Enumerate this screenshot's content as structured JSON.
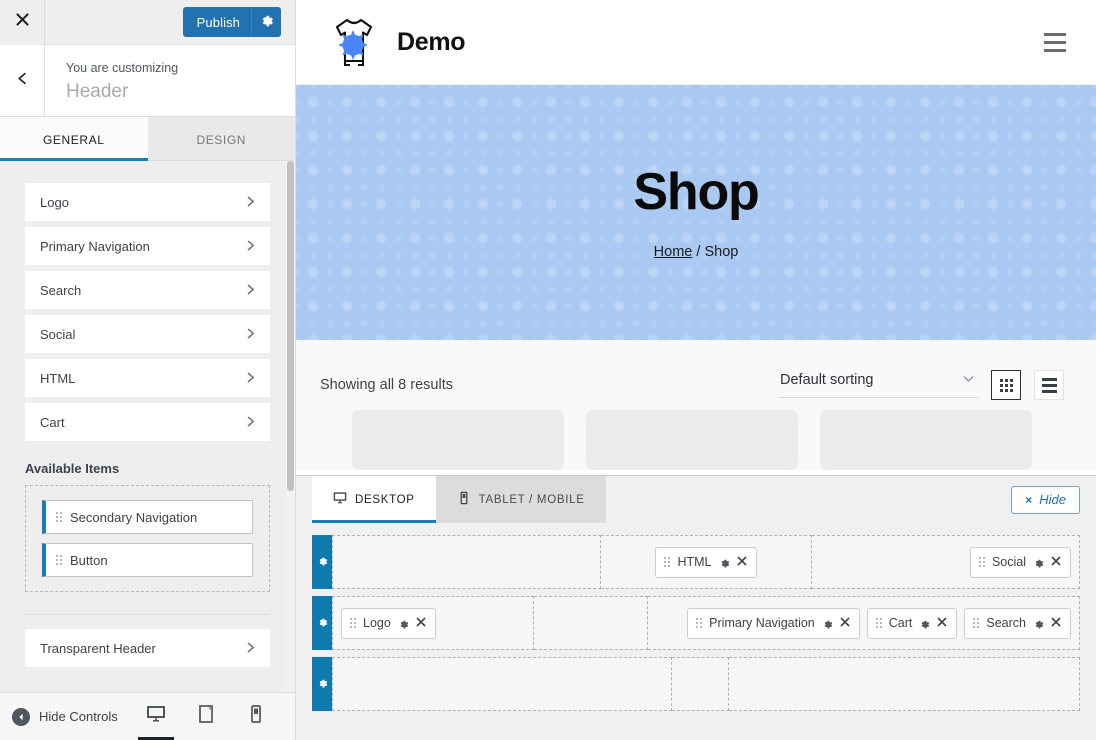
{
  "customizer": {
    "close_icon": "close-icon",
    "publish_label": "Publish",
    "publish_gear_icon": "gear-icon",
    "back_icon": "chevron-left-icon",
    "kicker": "You are customizing",
    "panel_title": "Header",
    "tabs": [
      {
        "label": "GENERAL",
        "active": true
      },
      {
        "label": "DESIGN",
        "active": false
      }
    ],
    "panel_rows": [
      {
        "label": "Logo"
      },
      {
        "label": "Primary Navigation"
      },
      {
        "label": "Search"
      },
      {
        "label": "Social"
      },
      {
        "label": "HTML"
      },
      {
        "label": "Cart"
      }
    ],
    "available_items_title": "Available Items",
    "available_items": [
      {
        "label": "Secondary Navigation"
      },
      {
        "label": "Button"
      }
    ],
    "transparent_header": {
      "label": "Transparent Header"
    },
    "footer": {
      "hide_controls_label": "Hide Controls",
      "devices": [
        {
          "name": "desktop",
          "active": true
        },
        {
          "name": "tablet",
          "active": false
        },
        {
          "name": "mobile",
          "active": false
        }
      ]
    },
    "accent_color": "#2271b1",
    "tab_underline_color": "#1a7fb3"
  },
  "preview": {
    "site_header": {
      "logo_icon": "tshirt-logo-icon",
      "brand": "Demo",
      "menu_icon": "hamburger-menu-icon"
    },
    "hero": {
      "title": "Shop",
      "breadcrumb_home": "Home",
      "breadcrumb_sep": "/",
      "breadcrumb_current": "Shop",
      "background_color": "#a9c9f2"
    },
    "shop": {
      "results_text": "Showing all 8 results",
      "sorting_value": "Default sorting",
      "sorting_caret_icon": "chevron-down-icon",
      "grid_view_icon": "grid-view-icon",
      "list_view_icon": "list-view-icon",
      "grid_active": true
    }
  },
  "builder": {
    "tabs": [
      {
        "label": "DESKTOP",
        "icon": "desktop-icon",
        "active": true
      },
      {
        "label": "TABLET / MOBILE",
        "icon": "mobile-icon",
        "active": false
      }
    ],
    "hide_label": "Hide",
    "hide_x": "×",
    "rows": [
      {
        "name": "top-row",
        "gear_icon": "gear-icon",
        "zones": [
          {
            "align": "left",
            "flex": 1.3,
            "items": []
          },
          {
            "align": "center",
            "flex": 1.0,
            "items": [
              {
                "label": "HTML",
                "gear_icon": "gear-icon",
                "remove_icon": "close-icon"
              }
            ]
          },
          {
            "align": "right",
            "flex": 1.3,
            "items": [
              {
                "label": "Social",
                "gear_icon": "gear-icon",
                "remove_icon": "close-icon"
              }
            ]
          }
        ]
      },
      {
        "name": "main-row",
        "gear_icon": "gear-icon",
        "zones": [
          {
            "align": "left",
            "flex": 0.62,
            "items": [
              {
                "label": "Logo",
                "gear_icon": "gear-icon",
                "remove_icon": "close-icon"
              }
            ]
          },
          {
            "align": "center",
            "flex": 0.33,
            "items": []
          },
          {
            "align": "right",
            "flex": 1.4,
            "items": [
              {
                "label": "Primary Navigation",
                "gear_icon": "gear-icon",
                "remove_icon": "close-icon"
              },
              {
                "label": "Cart",
                "gear_icon": "gear-icon",
                "remove_icon": "close-icon"
              },
              {
                "label": "Search",
                "gear_icon": "gear-icon",
                "remove_icon": "close-icon"
              }
            ]
          }
        ]
      },
      {
        "name": "bottom-row",
        "gear_icon": "gear-icon",
        "zones": [
          {
            "align": "left",
            "flex": 1.3,
            "items": []
          },
          {
            "align": "center",
            "flex": 0.16,
            "items": []
          },
          {
            "align": "right",
            "flex": 1.35,
            "items": []
          }
        ]
      }
    ]
  }
}
